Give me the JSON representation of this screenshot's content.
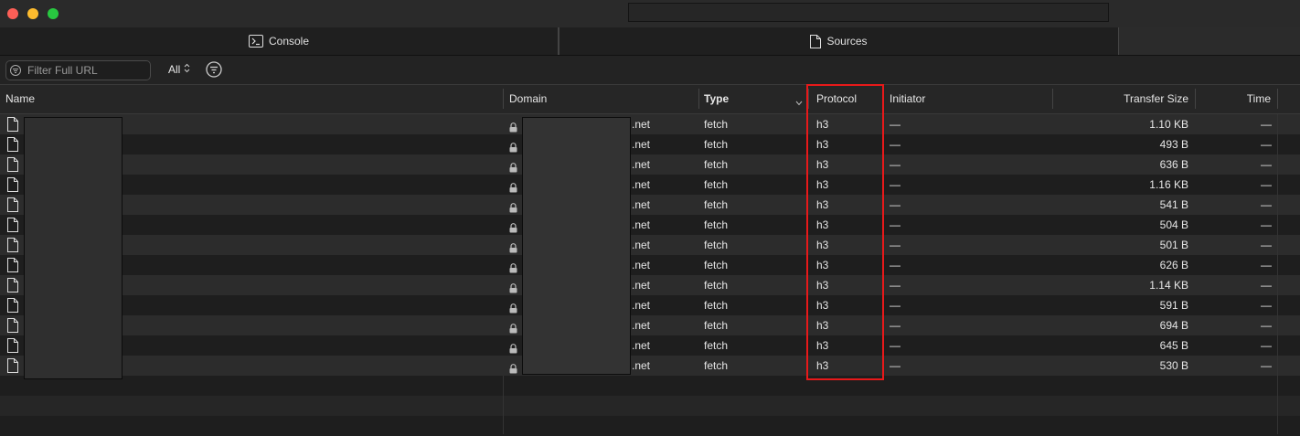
{
  "tabs": {
    "console": "Console",
    "sources": "Sources"
  },
  "filter": {
    "placeholder": "Filter Full URL",
    "scope": "All"
  },
  "columns": {
    "name": "Name",
    "domain": "Domain",
    "type": "Type",
    "protocol": "Protocol",
    "initiator": "Initiator",
    "transfer_size": "Transfer Size",
    "time": "Time"
  },
  "rows": [
    {
      "domain": ".net",
      "type": "fetch",
      "protocol": "h3",
      "initiator": "—",
      "size": "1.10 KB",
      "time": "—"
    },
    {
      "domain": ".net",
      "type": "fetch",
      "protocol": "h3",
      "initiator": "—",
      "size": "493 B",
      "time": "—"
    },
    {
      "domain": ".net",
      "type": "fetch",
      "protocol": "h3",
      "initiator": "—",
      "size": "636 B",
      "time": "—"
    },
    {
      "domain": ".net",
      "type": "fetch",
      "protocol": "h3",
      "initiator": "—",
      "size": "1.16 KB",
      "time": "—"
    },
    {
      "domain": ".net",
      "type": "fetch",
      "protocol": "h3",
      "initiator": "—",
      "size": "541 B",
      "time": "—"
    },
    {
      "domain": ".net",
      "type": "fetch",
      "protocol": "h3",
      "initiator": "—",
      "size": "504 B",
      "time": "—"
    },
    {
      "domain": ".net",
      "type": "fetch",
      "protocol": "h3",
      "initiator": "—",
      "size": "501 B",
      "time": "—"
    },
    {
      "domain": ".net",
      "type": "fetch",
      "protocol": "h3",
      "initiator": "—",
      "size": "626 B",
      "time": "—"
    },
    {
      "domain": ".net",
      "type": "fetch",
      "protocol": "h3",
      "initiator": "—",
      "size": "1.14 KB",
      "time": "—"
    },
    {
      "domain": ".net",
      "type": "fetch",
      "protocol": "h3",
      "initiator": "—",
      "size": "591 B",
      "time": "—"
    },
    {
      "domain": ".net",
      "type": "fetch",
      "protocol": "h3",
      "initiator": "—",
      "size": "694 B",
      "time": "—"
    },
    {
      "domain": ".net",
      "type": "fetch",
      "protocol": "h3",
      "initiator": "—",
      "size": "645 B",
      "time": "—"
    },
    {
      "domain": ".net",
      "type": "fetch",
      "protocol": "h3",
      "initiator": "—",
      "size": "530 B",
      "time": "—"
    }
  ],
  "icons": {
    "console_tab": "terminal-icon",
    "sources_tab": "document-icon",
    "filter": "filter-icon",
    "scope_toggle": "up-down-chevron-icon",
    "filter_options": "funnel-circle-icon",
    "row_name": "document-icon",
    "row_domain": "lock-icon"
  },
  "colors": {
    "window_close": "#fe5f57",
    "window_minimize": "#febc2e",
    "window_zoom": "#28c840",
    "highlight": "#e8191a"
  }
}
